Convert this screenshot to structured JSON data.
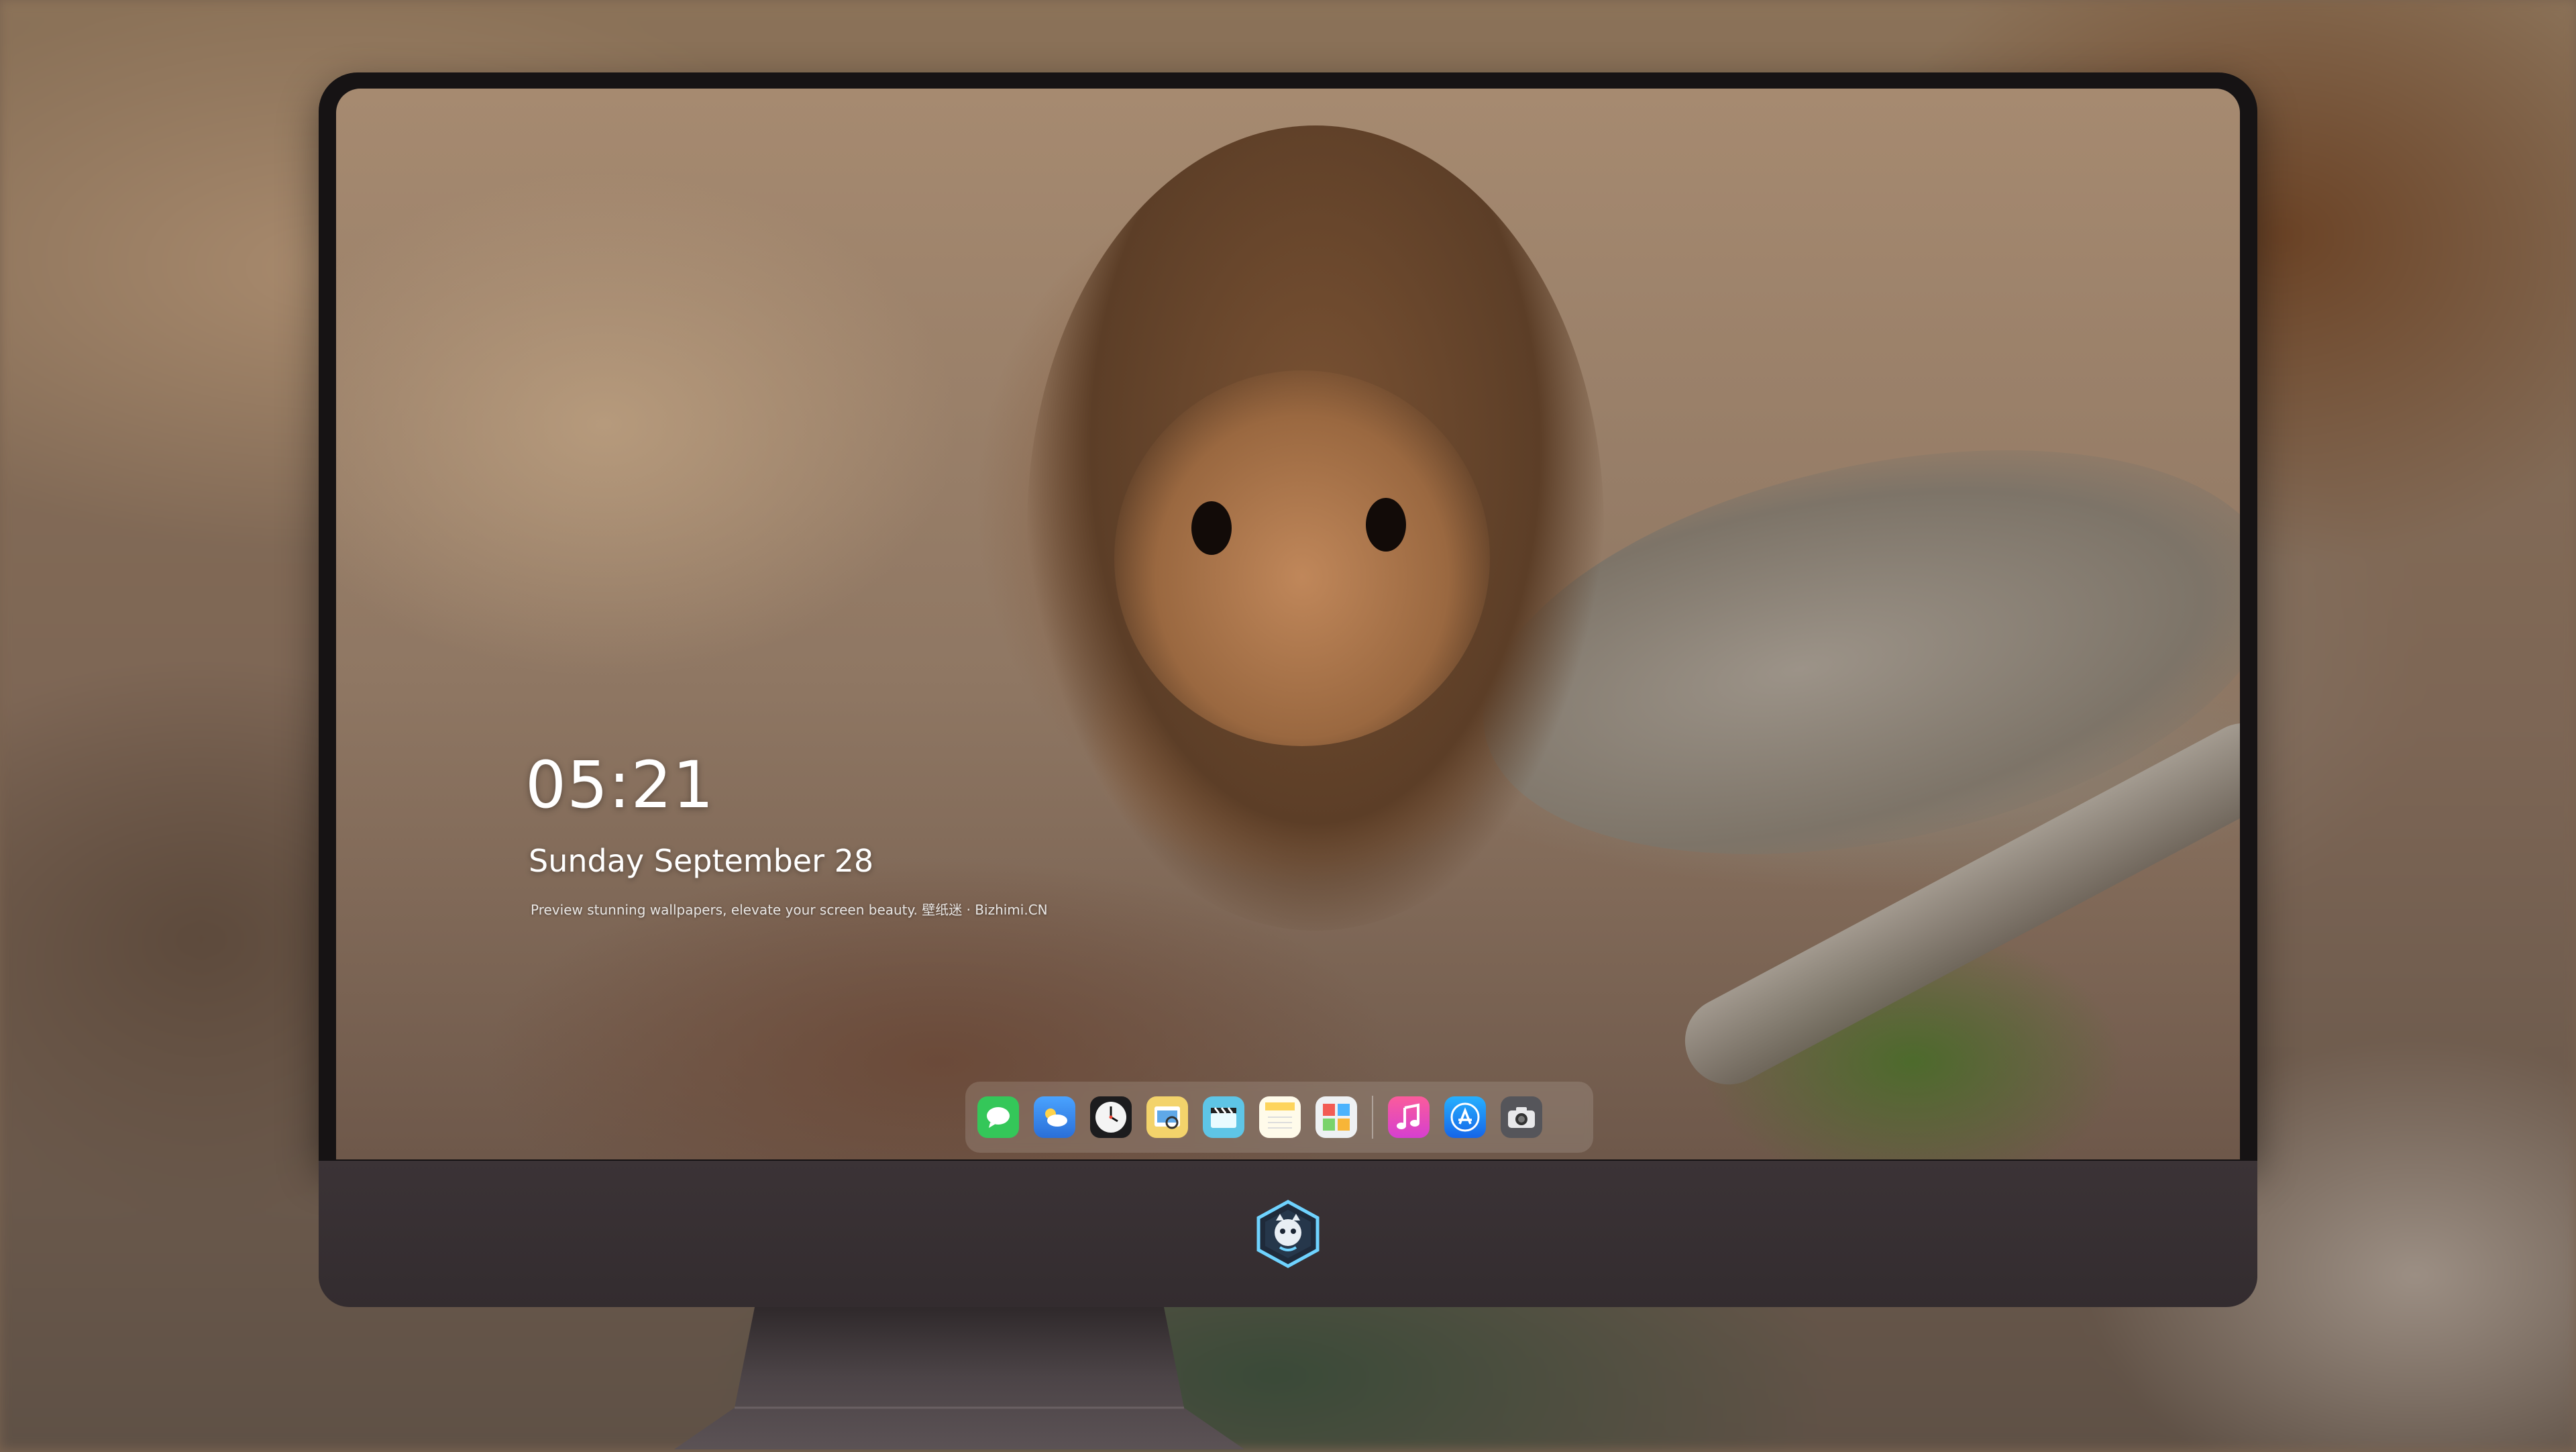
{
  "lockscreen": {
    "time": "05:21",
    "date": "Sunday September  28",
    "caption": "Preview stunning wallpapers, elevate your screen beauty. 壁纸迷 · Bizhimi.CN"
  },
  "dock": {
    "apps": [
      {
        "name": "messages",
        "icon": "messages-icon",
        "color": "#34c759"
      },
      {
        "name": "weather",
        "icon": "weather-icon",
        "color": "#3a8ef0"
      },
      {
        "name": "clock",
        "icon": "clock-icon",
        "color": "#f2f2f2"
      },
      {
        "name": "preview",
        "icon": "preview-icon",
        "color": "#e9b93a"
      },
      {
        "name": "claquette",
        "icon": "clapper-icon",
        "color": "#57c6e8"
      },
      {
        "name": "notes",
        "icon": "notes-icon",
        "color": "#fdd45c"
      },
      {
        "name": "photo-booth",
        "icon": "photo-grid-icon",
        "color": "#e8ecef"
      },
      {
        "name": "music",
        "icon": "music-icon",
        "color": "#f74d8c"
      },
      {
        "name": "app-store",
        "icon": "app-store-icon",
        "color": "#1b8ff5"
      },
      {
        "name": "camera",
        "icon": "camera-icon",
        "color": "#5e5e62"
      }
    ]
  },
  "colors": {
    "bezel": "#161314",
    "chin": "#3b3336",
    "stand": "#4a4245"
  }
}
